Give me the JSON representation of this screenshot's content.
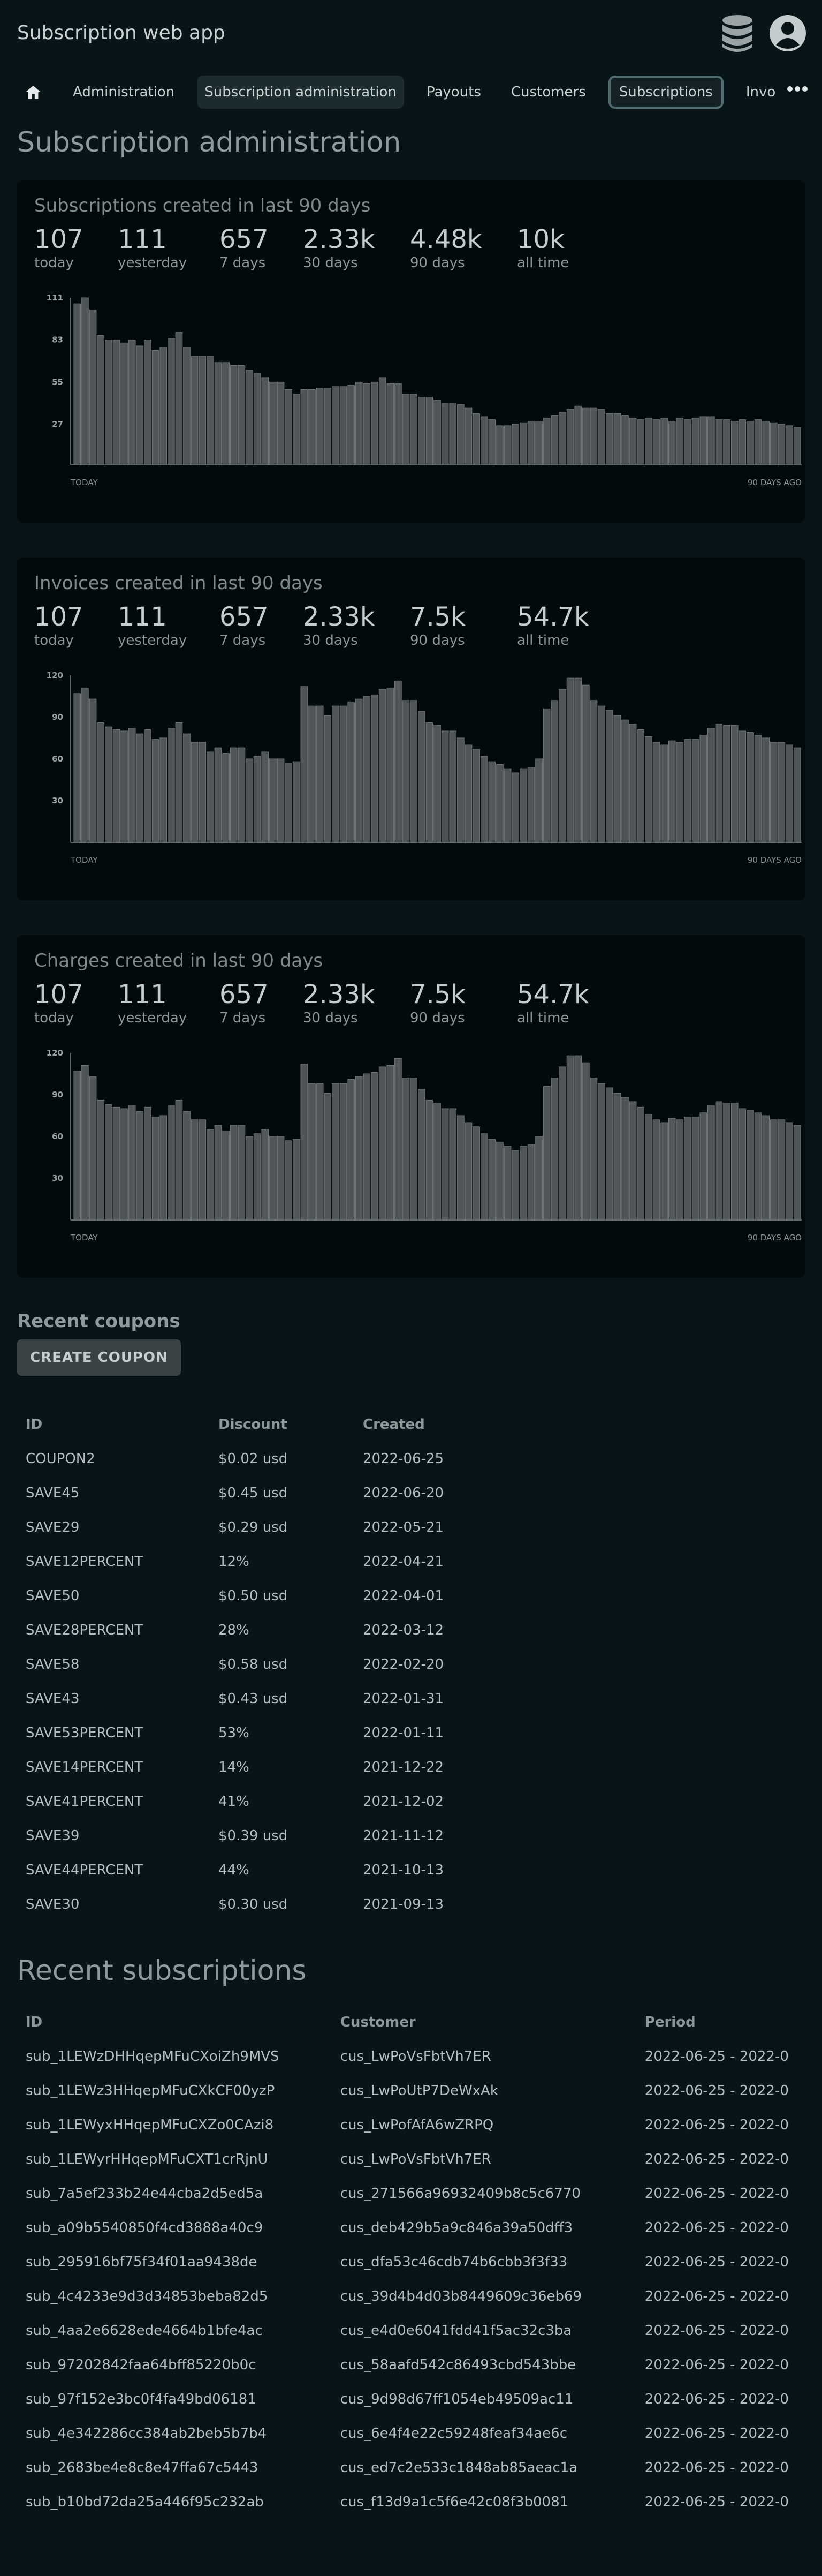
{
  "app": {
    "title": "Subscription web app"
  },
  "nav": {
    "items": [
      {
        "label": "Administration"
      },
      {
        "label": "Subscription administration"
      },
      {
        "label": "Payouts"
      },
      {
        "label": "Customers"
      },
      {
        "label": "Subscriptions"
      },
      {
        "label": "Invo"
      }
    ]
  },
  "page": {
    "title": "Subscription administration"
  },
  "cards": [
    {
      "title": "Subscriptions created in last 90 days",
      "stats": [
        {
          "value": "107",
          "label": "today"
        },
        {
          "value": "111",
          "label": "yesterday"
        },
        {
          "value": "657",
          "label": "7 days"
        },
        {
          "value": "2.33k",
          "label": "30 days"
        },
        {
          "value": "4.48k",
          "label": "90 days"
        },
        {
          "value": "10k",
          "label": "all time"
        }
      ]
    },
    {
      "title": "Invoices created in last 90 days",
      "stats": [
        {
          "value": "107",
          "label": "today"
        },
        {
          "value": "111",
          "label": "yesterday"
        },
        {
          "value": "657",
          "label": "7 days"
        },
        {
          "value": "2.33k",
          "label": "30 days"
        },
        {
          "value": "7.5k",
          "label": "90 days"
        },
        {
          "value": "54.7k",
          "label": "all time"
        }
      ]
    },
    {
      "title": "Charges created in last 90 days",
      "stats": [
        {
          "value": "107",
          "label": "today"
        },
        {
          "value": "111",
          "label": "yesterday"
        },
        {
          "value": "657",
          "label": "7 days"
        },
        {
          "value": "2.33k",
          "label": "30 days"
        },
        {
          "value": "7.5k",
          "label": "90 days"
        },
        {
          "value": "54.7k",
          "label": "all time"
        }
      ]
    }
  ],
  "chart_data": [
    {
      "type": "bar",
      "yticks": [
        111,
        83,
        55,
        27
      ],
      "ylim": [
        0,
        111
      ],
      "x_start_label": "TODAY",
      "x_end_label": "90 DAYS AGO",
      "values": [
        107,
        111,
        103,
        86,
        83,
        83,
        81,
        83,
        79,
        83,
        76,
        78,
        84,
        88,
        78,
        72,
        72,
        72,
        68,
        68,
        66,
        66,
        63,
        61,
        58,
        55,
        55,
        50,
        47,
        50,
        50,
        51,
        51,
        52,
        52,
        53,
        55,
        54,
        55,
        58,
        54,
        54,
        47,
        47,
        45,
        45,
        43,
        41,
        41,
        40,
        38,
        34,
        32,
        30,
        26,
        26,
        27,
        28,
        29,
        29,
        31,
        33,
        35,
        37,
        39,
        38,
        38,
        37,
        34,
        34,
        33,
        31,
        30,
        31,
        30,
        31,
        29,
        31,
        30,
        31,
        32,
        32,
        30,
        30,
        29,
        30,
        29,
        30,
        29,
        28,
        27,
        26,
        25
      ]
    },
    {
      "type": "bar",
      "yticks": [
        120,
        90,
        60,
        30
      ],
      "ylim": [
        0,
        120
      ],
      "x_start_label": "TODAY",
      "x_end_label": "90 DAYS AGO",
      "values": [
        107,
        111,
        103,
        86,
        83,
        81,
        80,
        82,
        78,
        81,
        74,
        75,
        82,
        86,
        78,
        72,
        72,
        65,
        68,
        64,
        68,
        68,
        60,
        62,
        65,
        60,
        60,
        57,
        58,
        112,
        98,
        98,
        91,
        98,
        98,
        101,
        103,
        105,
        106,
        110,
        111,
        116,
        102,
        102,
        94,
        86,
        84,
        80,
        80,
        75,
        70,
        67,
        62,
        58,
        56,
        53,
        50,
        53,
        54,
        60,
        96,
        102,
        110,
        118,
        118,
        113,
        102,
        98,
        95,
        91,
        88,
        85,
        81,
        76,
        72,
        70,
        73,
        72,
        74,
        74,
        77,
        82,
        85,
        84,
        84,
        80,
        79,
        77,
        75,
        72,
        72,
        70,
        68
      ]
    },
    {
      "type": "bar",
      "yticks": [
        120,
        90,
        60,
        30
      ],
      "ylim": [
        0,
        120
      ],
      "x_start_label": "TODAY",
      "x_end_label": "90 DAYS AGO",
      "values": [
        107,
        111,
        103,
        86,
        83,
        81,
        80,
        82,
        78,
        81,
        74,
        75,
        82,
        86,
        78,
        72,
        72,
        65,
        68,
        64,
        68,
        68,
        60,
        62,
        65,
        60,
        60,
        57,
        58,
        112,
        98,
        98,
        91,
        98,
        98,
        101,
        103,
        105,
        106,
        110,
        111,
        116,
        102,
        102,
        94,
        86,
        84,
        80,
        80,
        75,
        70,
        67,
        62,
        58,
        56,
        53,
        50,
        53,
        54,
        60,
        96,
        102,
        110,
        118,
        118,
        113,
        102,
        98,
        95,
        91,
        88,
        85,
        81,
        76,
        72,
        70,
        73,
        72,
        74,
        74,
        77,
        82,
        85,
        84,
        84,
        80,
        79,
        77,
        75,
        72,
        72,
        70,
        68
      ]
    }
  ],
  "coupons": {
    "heading": "Recent coupons",
    "create_label": "CREATE COUPON",
    "columns": [
      "ID",
      "Discount",
      "Created"
    ],
    "rows": [
      [
        "COUPON2",
        "$0.02 usd",
        "2022-06-25"
      ],
      [
        "SAVE45",
        "$0.45 usd",
        "2022-06-20"
      ],
      [
        "SAVE29",
        "$0.29 usd",
        "2022-05-21"
      ],
      [
        "SAVE12PERCENT",
        "12%",
        "2022-04-21"
      ],
      [
        "SAVE50",
        "$0.50 usd",
        "2022-04-01"
      ],
      [
        "SAVE28PERCENT",
        "28%",
        "2022-03-12"
      ],
      [
        "SAVE58",
        "$0.58 usd",
        "2022-02-20"
      ],
      [
        "SAVE43",
        "$0.43 usd",
        "2022-01-31"
      ],
      [
        "SAVE53PERCENT",
        "53%",
        "2022-01-11"
      ],
      [
        "SAVE14PERCENT",
        "14%",
        "2021-12-22"
      ],
      [
        "SAVE41PERCENT",
        "41%",
        "2021-12-02"
      ],
      [
        "SAVE39",
        "$0.39 usd",
        "2021-11-12"
      ],
      [
        "SAVE44PERCENT",
        "44%",
        "2021-10-13"
      ],
      [
        "SAVE30",
        "$0.30 usd",
        "2021-09-13"
      ]
    ]
  },
  "subscriptions": {
    "heading": "Recent subscriptions",
    "columns": [
      "ID",
      "Customer",
      "Period"
    ],
    "rows": [
      [
        "sub_1LEWzDHHqepMFuCXoiZh9MVS",
        "cus_LwPoVsFbtVh7ER",
        "2022-06-25 - 2022-0"
      ],
      [
        "sub_1LEWz3HHqepMFuCXkCF00yzP",
        "cus_LwPoUtP7DeWxAk",
        "2022-06-25 - 2022-0"
      ],
      [
        "sub_1LEWyxHHqepMFuCXZo0CAzi8",
        "cus_LwPofAfA6wZRPQ",
        "2022-06-25 - 2022-0"
      ],
      [
        "sub_1LEWyrHHqepMFuCXT1crRjnU",
        "cus_LwPoVsFbtVh7ER",
        "2022-06-25 - 2022-0"
      ],
      [
        "sub_7a5ef233b24e44cba2d5ed5a",
        "cus_271566a96932409b8c5c6770",
        "2022-06-25 - 2022-0"
      ],
      [
        "sub_a09b5540850f4cd3888a40c9",
        "cus_deb429b5a9c846a39a50dff3",
        "2022-06-25 - 2022-0"
      ],
      [
        "sub_295916bf75f34f01aa9438de",
        "cus_dfa53c46cdb74b6cbb3f3f33",
        "2022-06-25 - 2022-0"
      ],
      [
        "sub_4c4233e9d3d34853beba82d5",
        "cus_39d4b4d03b8449609c36eb69",
        "2022-06-25 - 2022-0"
      ],
      [
        "sub_4aa2e6628ede4664b1bfe4ac",
        "cus_e4d0e6041fdd41f5ac32c3ba",
        "2022-06-25 - 2022-0"
      ],
      [
        "sub_97202842faa64bff85220b0c",
        "cus_58aafd542c86493cbd543bbe",
        "2022-06-25 - 2022-0"
      ],
      [
        "sub_97f152e3bc0f4fa49bd06181",
        "cus_9d98d67ff1054eb49509ac11",
        "2022-06-25 - 2022-0"
      ],
      [
        "sub_4e342286cc384ab2beb5b7b4",
        "cus_6e4f4e22c59248feaf34ae6c",
        "2022-06-25 - 2022-0"
      ],
      [
        "sub_2683be4e8c8e47ffa67c5443",
        "cus_ed7c2e533c1848ab85aeac1a",
        "2022-06-25 - 2022-0"
      ],
      [
        "sub_b10bd72da25a446f95c232ab",
        "cus_f13d9a1c5f6e42c08f3b0081",
        "2022-06-25 - 2022-0"
      ]
    ]
  }
}
